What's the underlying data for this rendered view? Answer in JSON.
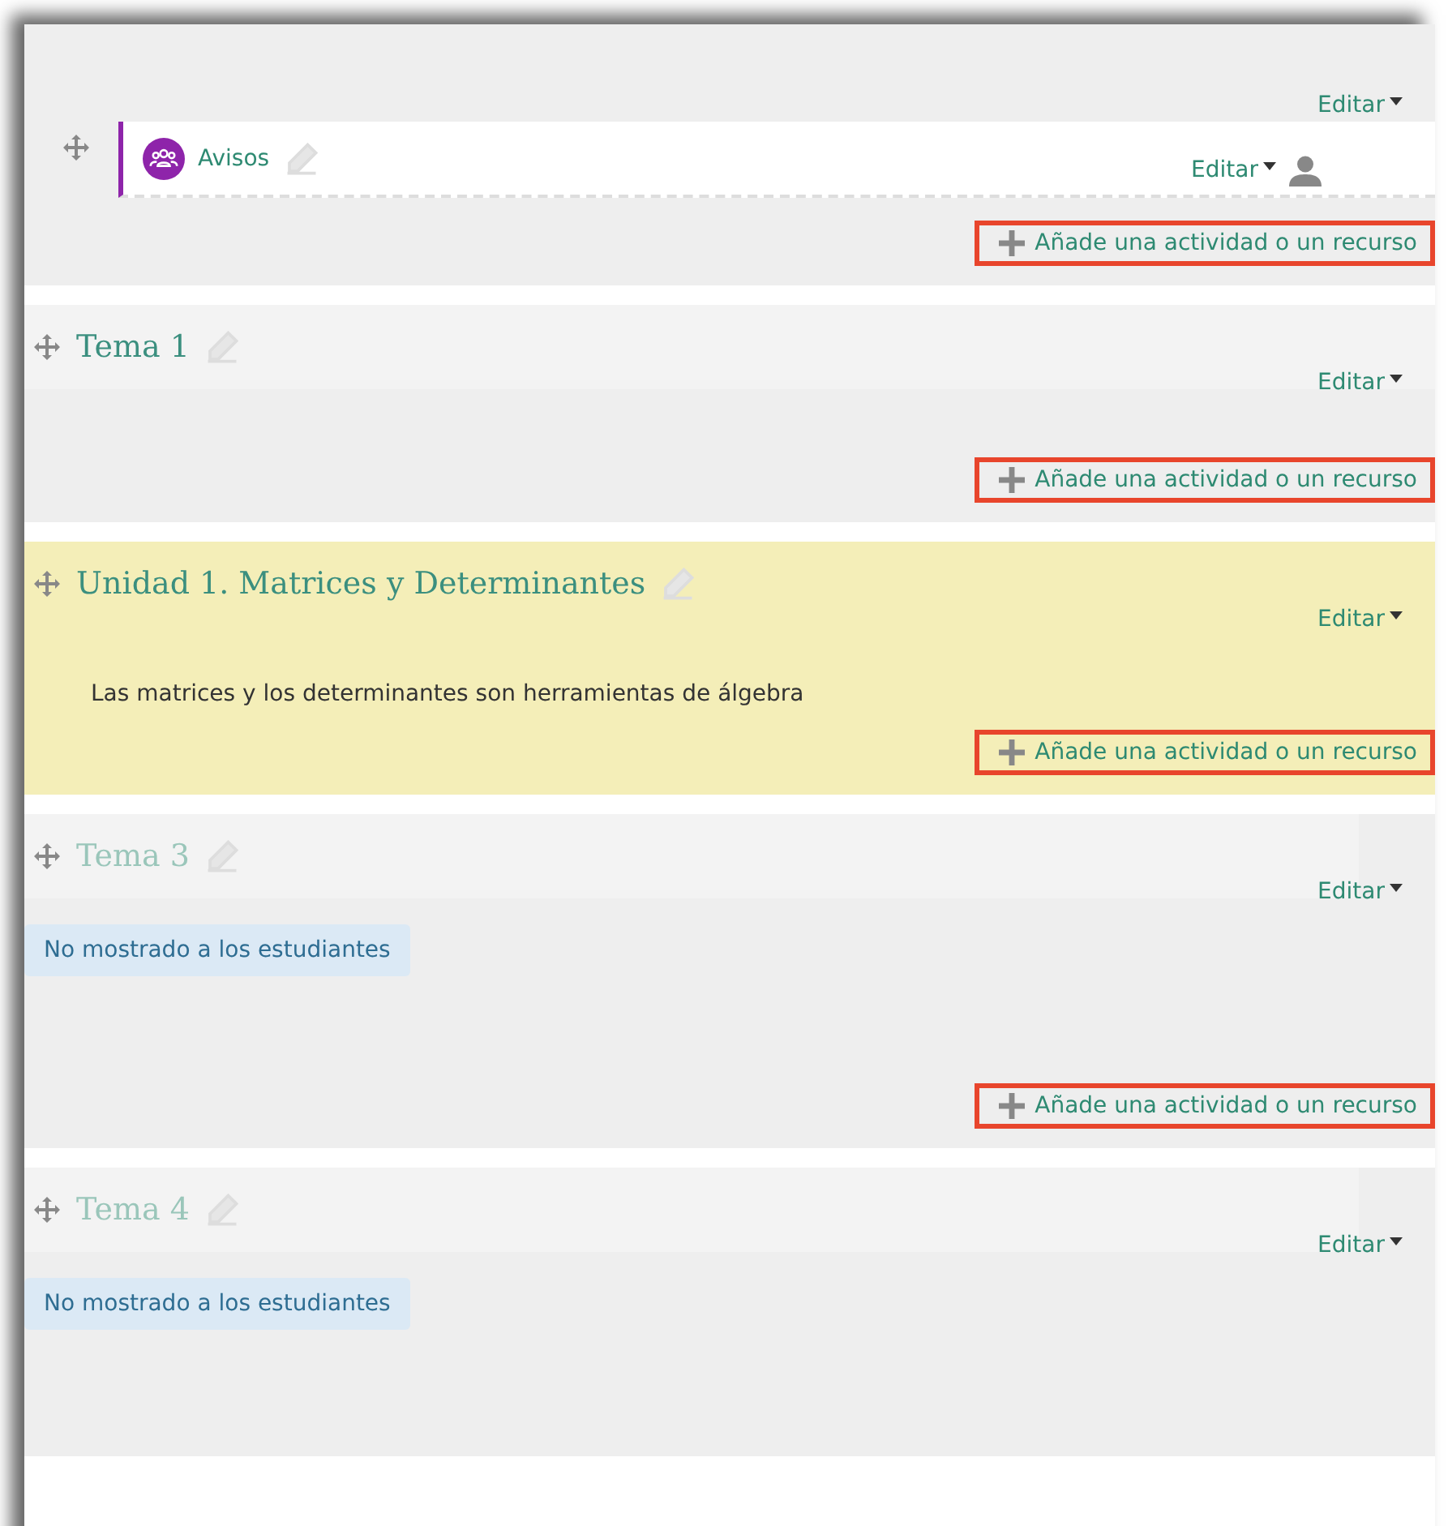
{
  "sections": [
    {
      "kind": "general",
      "highlighted": false,
      "hidden": false,
      "edit_label": "Editar",
      "activities": [
        {
          "name": "Avisos",
          "edit_label": "Editar"
        }
      ],
      "add_label": "Añade una actividad o un recurso",
      "add_outlined": true
    },
    {
      "kind": "topic",
      "title": "Tema 1",
      "highlighted": false,
      "hidden": false,
      "edit_label": "Editar",
      "add_label": "Añade una actividad o un recurso",
      "add_outlined": true
    },
    {
      "kind": "topic",
      "title": "Unidad 1. Matrices y Determinantes",
      "highlighted": true,
      "hidden": false,
      "edit_label": "Editar",
      "summary": "Las matrices y los determinantes son herramientas de álgebra",
      "add_label": "Añade una actividad o un recurso",
      "add_outlined": true
    },
    {
      "kind": "topic",
      "title": "Tema 3",
      "highlighted": false,
      "hidden": true,
      "edit_label": "Editar",
      "badge": "No mostrado a los estudiantes",
      "add_label": "Añade una actividad o un recurso",
      "add_outlined": true
    },
    {
      "kind": "topic",
      "title": "Tema 4",
      "highlighted": false,
      "hidden": true,
      "edit_label": "Editar",
      "badge": "No mostrado a los estudiantes"
    }
  ]
}
